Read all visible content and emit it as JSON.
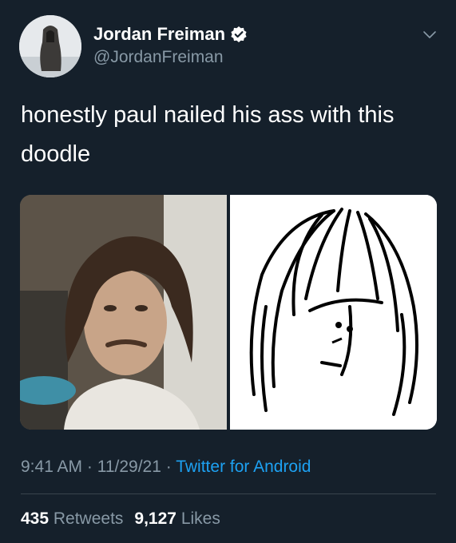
{
  "header": {
    "display_name": "Jordan Freiman",
    "handle": "@JordanFreiman",
    "verified_icon": "verified-badge-icon",
    "more_icon": "chevron-down-icon"
  },
  "tweet": {
    "text": "honestly paul nailed his ass with this doodle"
  },
  "media": [
    {
      "kind": "photo",
      "icon": "photo-portrait"
    },
    {
      "kind": "drawing",
      "icon": "doodle-drawing"
    }
  ],
  "meta": {
    "time": "9:41 AM",
    "sep1": " · ",
    "date": "11/29/21",
    "sep2": " · ",
    "source": "Twitter for Android"
  },
  "stats": {
    "retweets_count": "435",
    "retweets_label": " Retweets",
    "likes_count": "9,127",
    "likes_label": " Likes"
  },
  "colors": {
    "background": "#15202b",
    "secondary_text": "#8899a6",
    "link": "#1da1f2",
    "verified": "#ffffff"
  }
}
